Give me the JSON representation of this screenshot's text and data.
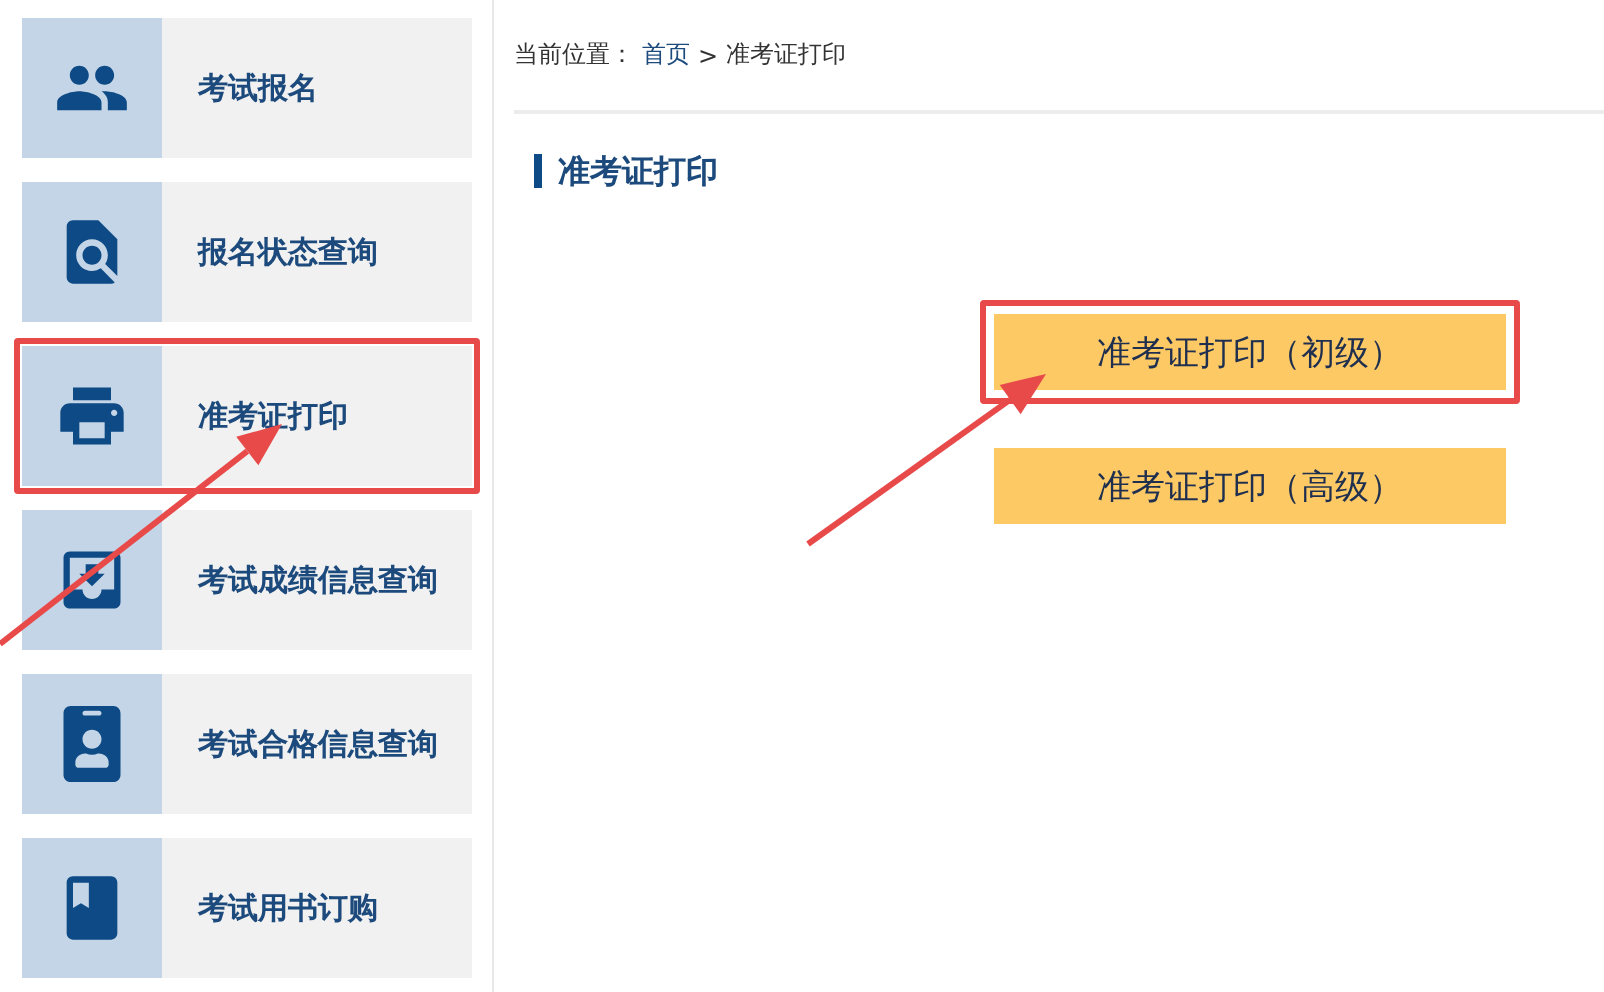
{
  "sidebar": {
    "items": [
      {
        "label": "考试报名",
        "highlighted": false
      },
      {
        "label": "报名状态查询",
        "highlighted": false
      },
      {
        "label": "准考证打印",
        "highlighted": true
      },
      {
        "label": "考试成绩信息查询",
        "highlighted": false
      },
      {
        "label": "考试合格信息查询",
        "highlighted": false
      },
      {
        "label": "考试用书订购",
        "highlighted": false
      }
    ]
  },
  "breadcrumb": {
    "label": "当前位置：",
    "separator": ">",
    "items": [
      {
        "text": "首页",
        "link": true
      },
      {
        "text": "准考证打印",
        "link": false
      }
    ]
  },
  "heading": "准考证打印",
  "buttons": [
    {
      "label": "准考证打印（初级）",
      "highlighted": true
    },
    {
      "label": "准考证打印（高级）",
      "highlighted": false
    }
  ]
}
